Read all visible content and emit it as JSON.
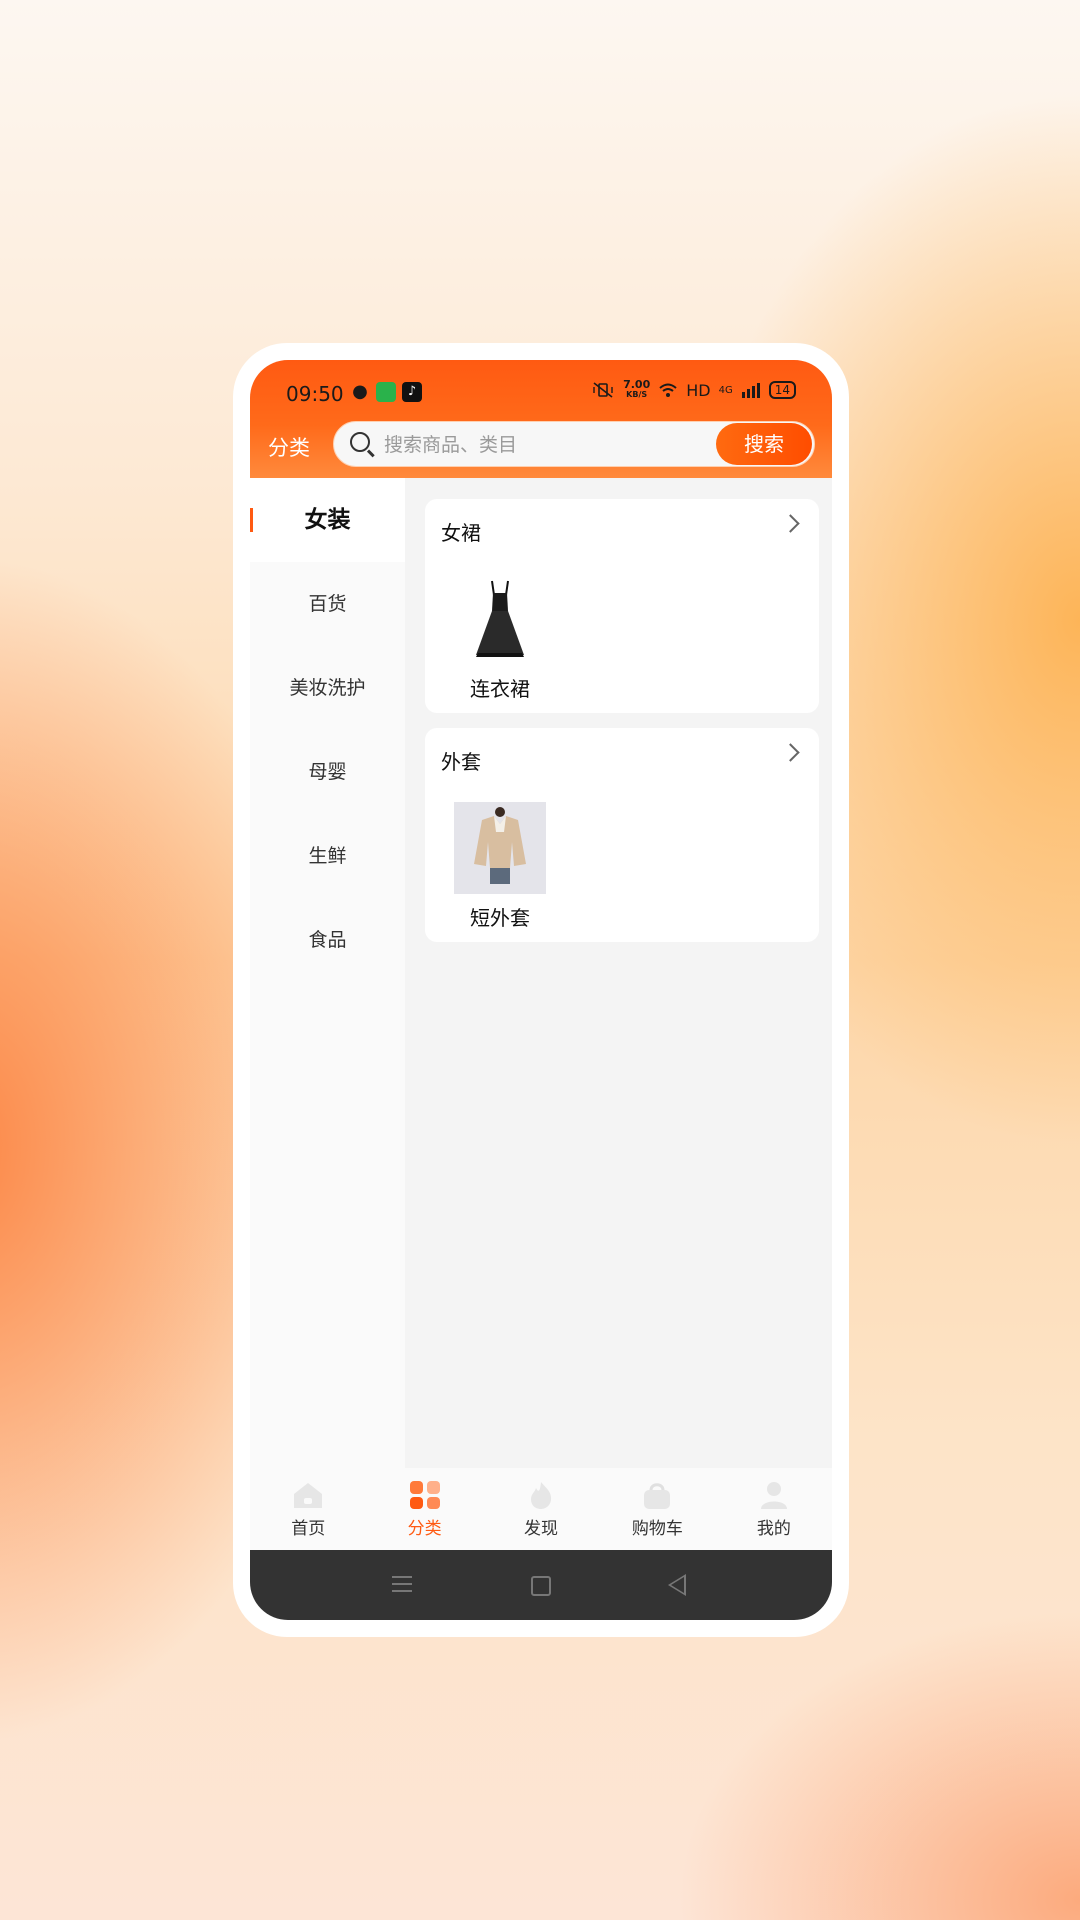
{
  "status_bar": {
    "time": "09:50",
    "net_speed_value": "7.00",
    "net_speed_unit": "KB/S",
    "hd": "HD",
    "network": "4G",
    "battery": "14"
  },
  "header": {
    "title": "分类",
    "search_placeholder": "搜索商品、类目",
    "search_button": "搜索"
  },
  "sidebar": {
    "items": [
      {
        "label": "女装",
        "active": true
      },
      {
        "label": "百货"
      },
      {
        "label": "美妆洗护"
      },
      {
        "label": "母婴"
      },
      {
        "label": "生鲜"
      },
      {
        "label": "食品"
      }
    ]
  },
  "content": {
    "sections": [
      {
        "title": "女裙",
        "products": [
          {
            "label": "连衣裙",
            "icon": "dress-image"
          }
        ]
      },
      {
        "title": "外套",
        "products": [
          {
            "label": "短外套",
            "icon": "jacket-image"
          }
        ]
      }
    ]
  },
  "tabbar": {
    "tabs": [
      {
        "label": "首页",
        "icon": "home-icon"
      },
      {
        "label": "分类",
        "icon": "category-icon",
        "active": true
      },
      {
        "label": "发现",
        "icon": "flame-icon"
      },
      {
        "label": "购物车",
        "icon": "bag-icon"
      },
      {
        "label": "我的",
        "icon": "user-icon"
      }
    ]
  },
  "colors": {
    "accent": "#ff5a12",
    "header_gradient_start": "#ff5a12",
    "header_gradient_end": "#ff8a3c"
  }
}
